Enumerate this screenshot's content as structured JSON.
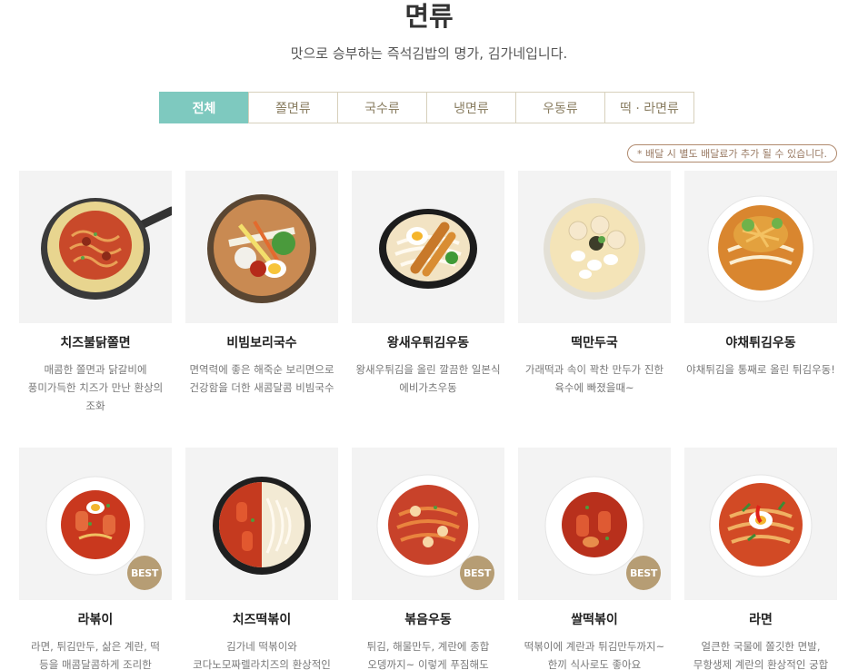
{
  "header": {
    "title": "면류",
    "subtitle": "맛으로 승부하는 즉석김밥의 명가, 김가네입니다."
  },
  "tabs": [
    {
      "label": "전체",
      "active": true
    },
    {
      "label": "쫄면류",
      "active": false
    },
    {
      "label": "국수류",
      "active": false
    },
    {
      "label": "냉면류",
      "active": false
    },
    {
      "label": "우동류",
      "active": false
    },
    {
      "label": "떡 · 라면류",
      "active": false
    }
  ],
  "notice": "* 배달 시 별도 배달료가 추가 될 수 있습니다.",
  "menu": [
    {
      "name": "치즈불닭쫄면",
      "desc": "매콤한 쫄면과 닭갈비에 풍미가득한 치즈가 만난 환상의 조화",
      "best": false,
      "dish": "skillet"
    },
    {
      "name": "비빔보리국수",
      "desc": "면역력에 좋은 해죽순 보리면으로 건강함을 더한 새콤달콤 비빔국수",
      "best": false,
      "dish": "bibim"
    },
    {
      "name": "왕새우튀김우동",
      "desc": "왕새우튀김을 올린 깔끔한 일본식 에비가츠우동",
      "best": false,
      "dish": "shrimp"
    },
    {
      "name": "떡만두국",
      "desc": "가래떡과 속이 꽉찬 만두가 진한 육수에 빠졌을때~",
      "best": false,
      "dish": "dumpling"
    },
    {
      "name": "야채튀김우동",
      "desc": "야채튀김을 통째로 올린 튀김우동!",
      "best": false,
      "dish": "veggie"
    },
    {
      "name": "라볶이",
      "desc": "라면, 튀김만두, 삶은 계란, 떡 등을 매콤달콤하게 조리한 볶음라면",
      "best": true,
      "dish": "rabokki"
    },
    {
      "name": "치즈떡볶이",
      "desc": "김가네 떡볶이와 코다노모짜렐라치즈의 환상적인 콜라보",
      "best": false,
      "dish": "cheese"
    },
    {
      "name": "볶음우동",
      "desc": "튀김, 해물만두, 계란에 종합 오뎅까지~ 이렇게 푸짐해도 되나요?",
      "best": true,
      "dish": "fried-udon"
    },
    {
      "name": "쌀떡볶이",
      "desc": "떡볶이에 계란과 튀김만두까지~ 한끼 식사로도 좋아요",
      "best": true,
      "dish": "ricecake"
    },
    {
      "name": "라면",
      "desc": "얼큰한 국물에 쫄깃한 면발, 무항생제 계란의 환상적인 궁합",
      "best": false,
      "dish": "ramen"
    }
  ],
  "best_label": "BEST",
  "colors": {
    "tab_active": "#7ec9bf",
    "tab_border": "#d7d0bc",
    "best_badge": "#b69d74",
    "thumb_bg": "#f3f3f3"
  }
}
